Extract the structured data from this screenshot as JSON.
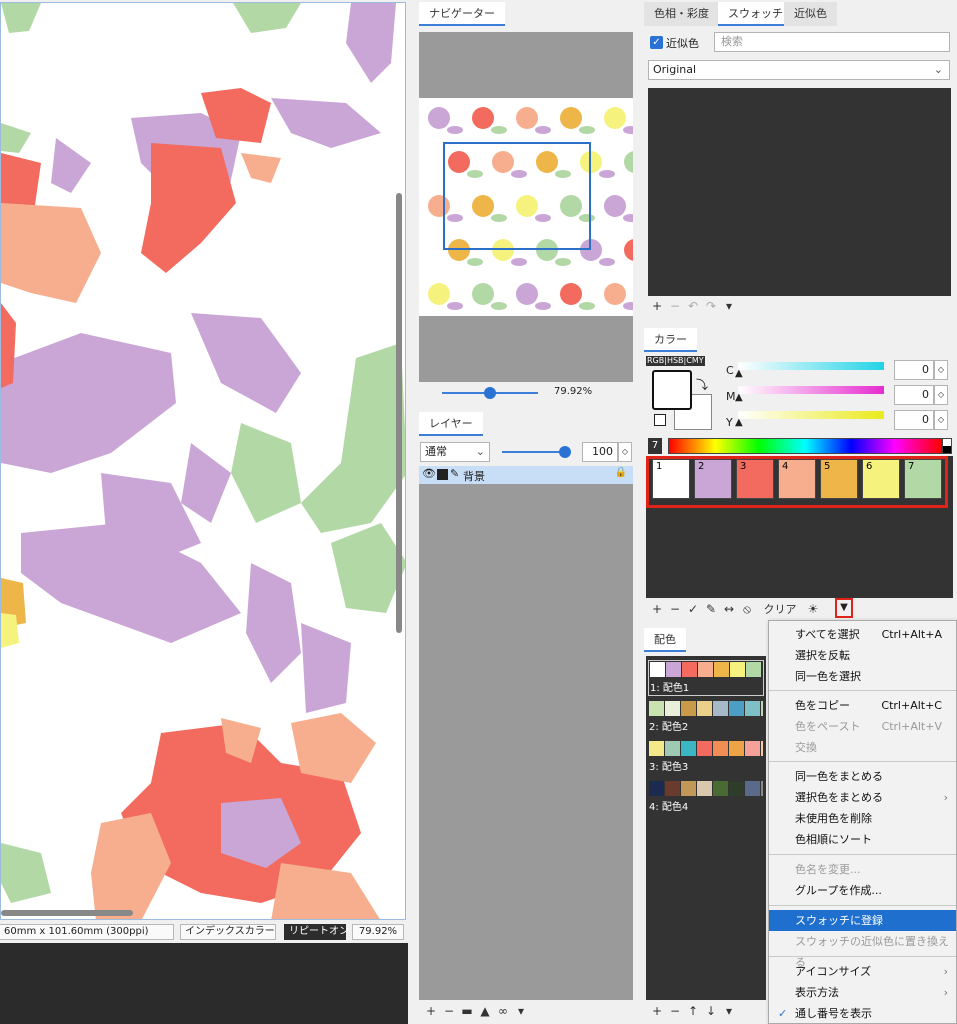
{
  "statusbar": {
    "size": "60mm x 101.60mm (300ppi)",
    "mode": "インデックスカラー",
    "repeat": "リピートオン",
    "zoom": "79.92%"
  },
  "navigator": {
    "tab": "ナビゲーター",
    "zoom": "79.92%"
  },
  "layers": {
    "tab": "レイヤー",
    "blend": "通常",
    "opacity": "100",
    "layer_name": "背景"
  },
  "right": {
    "tabs": [
      "色相・彩度",
      "スウォッチ",
      "近似色"
    ],
    "nearcolor_label": "近似色",
    "search_placeholder": "検索",
    "preset": "Original",
    "color_tab": "カラー",
    "modes": [
      "RGB",
      "HSB",
      "CMY"
    ],
    "cmy": [
      {
        "label": "C",
        "value": "0"
      },
      {
        "label": "M",
        "value": "0"
      },
      {
        "label": "Y",
        "value": "0"
      }
    ],
    "palette_count": "7",
    "swatches": [
      {
        "num": "1",
        "color": "#ffffff"
      },
      {
        "num": "2",
        "color": "#c9a6d6"
      },
      {
        "num": "3",
        "color": "#f26b5e"
      },
      {
        "num": "4",
        "color": "#f6ae8e"
      },
      {
        "num": "5",
        "color": "#eeb648"
      },
      {
        "num": "6",
        "color": "#f6f27e"
      },
      {
        "num": "7",
        "color": "#b2d8a6"
      }
    ],
    "swatch_clear": "クリア",
    "scheme_tab": "配色",
    "schemes": [
      {
        "label": "1: 配色1",
        "colors": [
          "#ffffff",
          "#c9a6d6",
          "#f26b5e",
          "#f6ae8e",
          "#eeb648",
          "#f6f27e",
          "#b2d8a6",
          "#d8e3c8"
        ]
      },
      {
        "label": "2: 配色2",
        "colors": [
          "#c8e3b0",
          "#e8f0da",
          "#c89a4a",
          "#ead08a",
          "#a7b9c8",
          "#4c9ec4",
          "#7ec0c6",
          "#bcd8b8"
        ]
      },
      {
        "label": "3: 配色3",
        "colors": [
          "#f4e98a",
          "#9ec9b2",
          "#3bb7c4",
          "#f26b5e",
          "#f08e54",
          "#eea346",
          "#f6a09a",
          "#f9c9a6"
        ]
      },
      {
        "label": "4: 配色4",
        "colors": [
          "#1b2a4e",
          "#6a3b2d",
          "#c29858",
          "#d9c8ad",
          "#4a6a34",
          "#2d3d2a",
          "#5a6a8a",
          "#8a8a8a"
        ]
      }
    ]
  },
  "menu": {
    "items": [
      {
        "label": "すべてを選択",
        "shortcut": "Ctrl+Alt+A"
      },
      {
        "label": "選択を反転"
      },
      {
        "label": "同一色を選択"
      },
      {
        "label": "色をコピー",
        "shortcut": "Ctrl+Alt+C"
      },
      {
        "label": "色をペースト",
        "shortcut": "Ctrl+Alt+V"
      },
      {
        "label": "交換"
      },
      {
        "label": "同一色をまとめる"
      },
      {
        "label": "選択色をまとめる"
      },
      {
        "label": "未使用色を削除"
      },
      {
        "label": "色相順にソート"
      },
      {
        "label": "色名を変更..."
      },
      {
        "label": "グループを作成..."
      },
      {
        "label": "スウォッチに登録"
      },
      {
        "label": "スウォッチの近似色に置き換える"
      },
      {
        "label": "アイコンサイズ"
      },
      {
        "label": "表示方法"
      },
      {
        "label": "通し番号を表示"
      }
    ]
  }
}
